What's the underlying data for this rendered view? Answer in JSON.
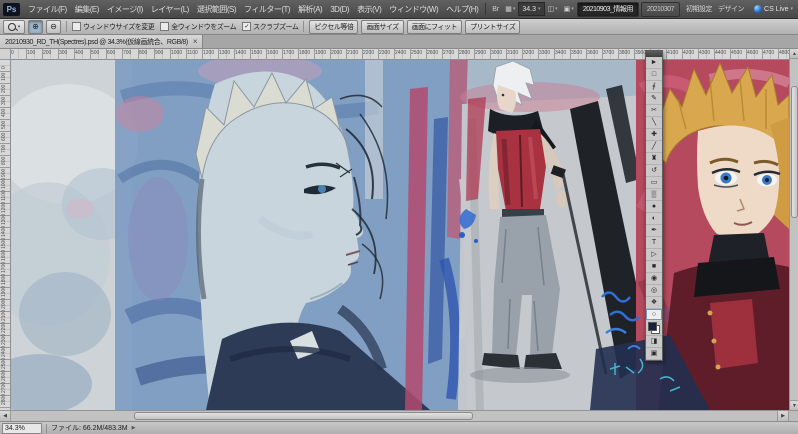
{
  "ui": {
    "dropdown_arrow": "▾",
    "check_glyph": "✓",
    "scroll_left": "◀",
    "scroll_right": "▶",
    "scroll_up": "▲",
    "scroll_down": "▼",
    "flyout_arrow": "▶"
  },
  "app_bar": {
    "logo_label": "Ps",
    "menus": [
      "ファイル(F)",
      "編集(E)",
      "イメージ(I)",
      "レイヤー(L)",
      "選択範囲(S)",
      "フィルター(T)",
      "解析(A)",
      "3D(D)",
      "表示(V)",
      "ウィンドウ(W)",
      "ヘルプ(H)"
    ],
    "icons_left": [
      {
        "name": "bridge-icon",
        "glyph": "Br",
        "dropdown": false
      },
      {
        "name": "view-extras-icon",
        "glyph": "▦",
        "dropdown": true
      }
    ],
    "zoom_level_value": "34.3",
    "icons_right": [
      {
        "name": "arrange-documents-icon",
        "glyph": "◫",
        "dropdown": true
      },
      {
        "name": "screen-mode-icon",
        "glyph": "▣",
        "dropdown": true
      }
    ],
    "workspace_tabs": [
      {
        "label": "20210903_情報用",
        "active": true
      },
      {
        "label": "20210307",
        "active": false
      }
    ],
    "workspace_links": [
      "初期設定",
      "デザイン"
    ],
    "cs_live_label": "CS Live"
  },
  "options_bar": {
    "tool_name": "zoom-tool",
    "zoom_in_glyph": "⊕",
    "zoom_out_glyph": "⊖",
    "checkboxes": [
      {
        "label": "ウィンドウサイズを変更",
        "checked": false
      },
      {
        "label": "全ウィンドウをズーム",
        "checked": false
      },
      {
        "label": "スクラブズーム",
        "checked": true
      }
    ],
    "buttons": [
      "ピクセル等倍",
      "画面サイズ",
      "画面にフィット",
      "プリントサイズ"
    ]
  },
  "document_tab": {
    "title": "20210930_RD_TH(Spectres).psd @ 34.3%(仮線画統合、RGB/8)",
    "close_label": "×"
  },
  "rulers": {
    "horizontal_step": 100,
    "horizontal_max": 4800,
    "vertical_step": 100,
    "vertical_max": 2800
  },
  "tools": [
    {
      "name": "move-tool",
      "glyph": "►"
    },
    {
      "name": "rectangular-marquee-tool",
      "glyph": "□"
    },
    {
      "name": "lasso-tool",
      "glyph": "∮"
    },
    {
      "name": "quick-selection-tool",
      "glyph": "✎"
    },
    {
      "name": "crop-tool",
      "glyph": "✂"
    },
    {
      "name": "eyedropper-tool",
      "glyph": "╲"
    },
    {
      "name": "spot-healing-brush-tool",
      "glyph": "✚"
    },
    {
      "name": "brush-tool",
      "glyph": "╱"
    },
    {
      "name": "clone-stamp-tool",
      "glyph": "♜"
    },
    {
      "name": "history-brush-tool",
      "glyph": "↺"
    },
    {
      "name": "eraser-tool",
      "glyph": "▭"
    },
    {
      "name": "gradient-tool",
      "glyph": "▒"
    },
    {
      "name": "blur-tool",
      "glyph": "●"
    },
    {
      "name": "dodge-tool",
      "glyph": "◐"
    },
    {
      "name": "pen-tool",
      "glyph": "✒"
    },
    {
      "name": "type-tool",
      "glyph": "T"
    },
    {
      "name": "path-selection-tool",
      "glyph": "▷"
    },
    {
      "name": "rectangle-tool",
      "glyph": "■"
    },
    {
      "name": "3d-object-rotate-tool",
      "glyph": "◉"
    },
    {
      "name": "3d-camera-rotate-tool",
      "glyph": "◎"
    },
    {
      "name": "hand-tool",
      "glyph": "❖"
    },
    {
      "name": "zoom-tool",
      "glyph": "○",
      "selected": true
    },
    {
      "name": "foreground-background-colors"
    },
    {
      "name": "quick-mask-button",
      "glyph": "◨"
    },
    {
      "name": "screen-mode-button",
      "glyph": "▣"
    }
  ],
  "status_bar": {
    "zoom_value": "34.3%",
    "document_info": "ファイル: 66.2M/483.3M"
  },
  "canvas_colors": {
    "blue_wash": "#7d9bc2",
    "skin_pale": "#c8d5dd",
    "red_top": "#a83240",
    "right_field_red": "#b5495d",
    "blonde_hair": "#d9a84e",
    "scribble_blue": "#2f6fd8"
  }
}
